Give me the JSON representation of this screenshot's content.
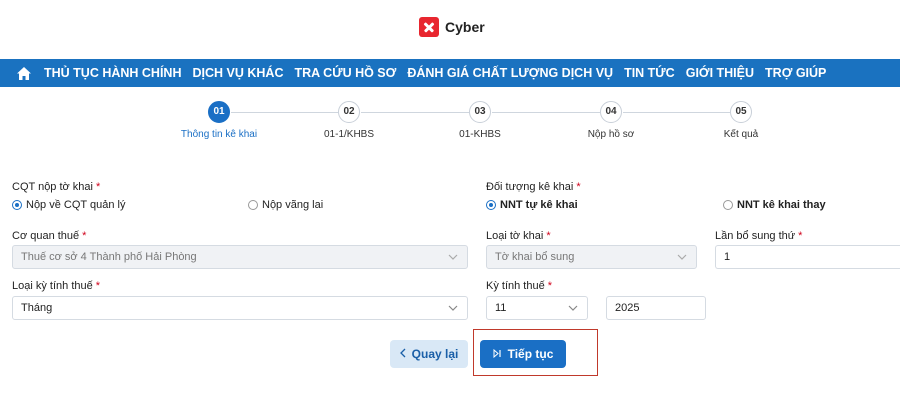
{
  "brand": {
    "name": "Cyber"
  },
  "nav": {
    "items": [
      "THỦ TỤC HÀNH CHÍNH",
      "DỊCH VỤ KHÁC",
      "TRA CỨU HỒ SƠ",
      "ĐÁNH GIÁ CHẤT LƯỢNG DỊCH VỤ",
      "TIN TỨC",
      "GIỚI THIỆU",
      "TRỢ GIÚP"
    ]
  },
  "stepper": {
    "active_index": 0,
    "steps": [
      {
        "number": "01",
        "label": "Thông tin kê khai"
      },
      {
        "number": "02",
        "label": "01-1/KHBS"
      },
      {
        "number": "03",
        "label": "01-KHBS"
      },
      {
        "number": "04",
        "label": "Nộp hồ sơ"
      },
      {
        "number": "05",
        "label": "Kết quả"
      }
    ]
  },
  "form": {
    "cqt_nop": {
      "label": "CQT nộp tờ khai",
      "options": [
        "Nộp về CQT quản lý",
        "Nộp vãng lai"
      ],
      "selected": "Nộp về CQT quản lý"
    },
    "doi_tuong": {
      "label": "Đối tượng kê khai",
      "options": [
        "NNT tự kê khai",
        "NNT kê khai thay"
      ],
      "selected": "NNT tự kê khai"
    },
    "co_quan_thue": {
      "label": "Cơ quan thuế",
      "value": "Thuế cơ sở 4 Thành phố Hải Phòng"
    },
    "loai_to_khai": {
      "label": "Loại tờ khai",
      "value": "Tờ khai bổ sung"
    },
    "lan_bo_sung": {
      "label": "Lần bổ sung thứ",
      "value": "1"
    },
    "loai_ky": {
      "label": "Loại kỳ tính thuế",
      "value": "Tháng"
    },
    "ky_tinh_thue": {
      "label": "Kỳ tính thuế",
      "month": "11",
      "year": "2025"
    },
    "required_mark": "*"
  },
  "buttons": {
    "back": "Quay lại",
    "next": "Tiếp tục"
  },
  "colors": {
    "primary": "#1a6fc5",
    "nav_bg": "#1a72c0",
    "required": "#d0021b",
    "highlight_border": "#c0392b"
  }
}
